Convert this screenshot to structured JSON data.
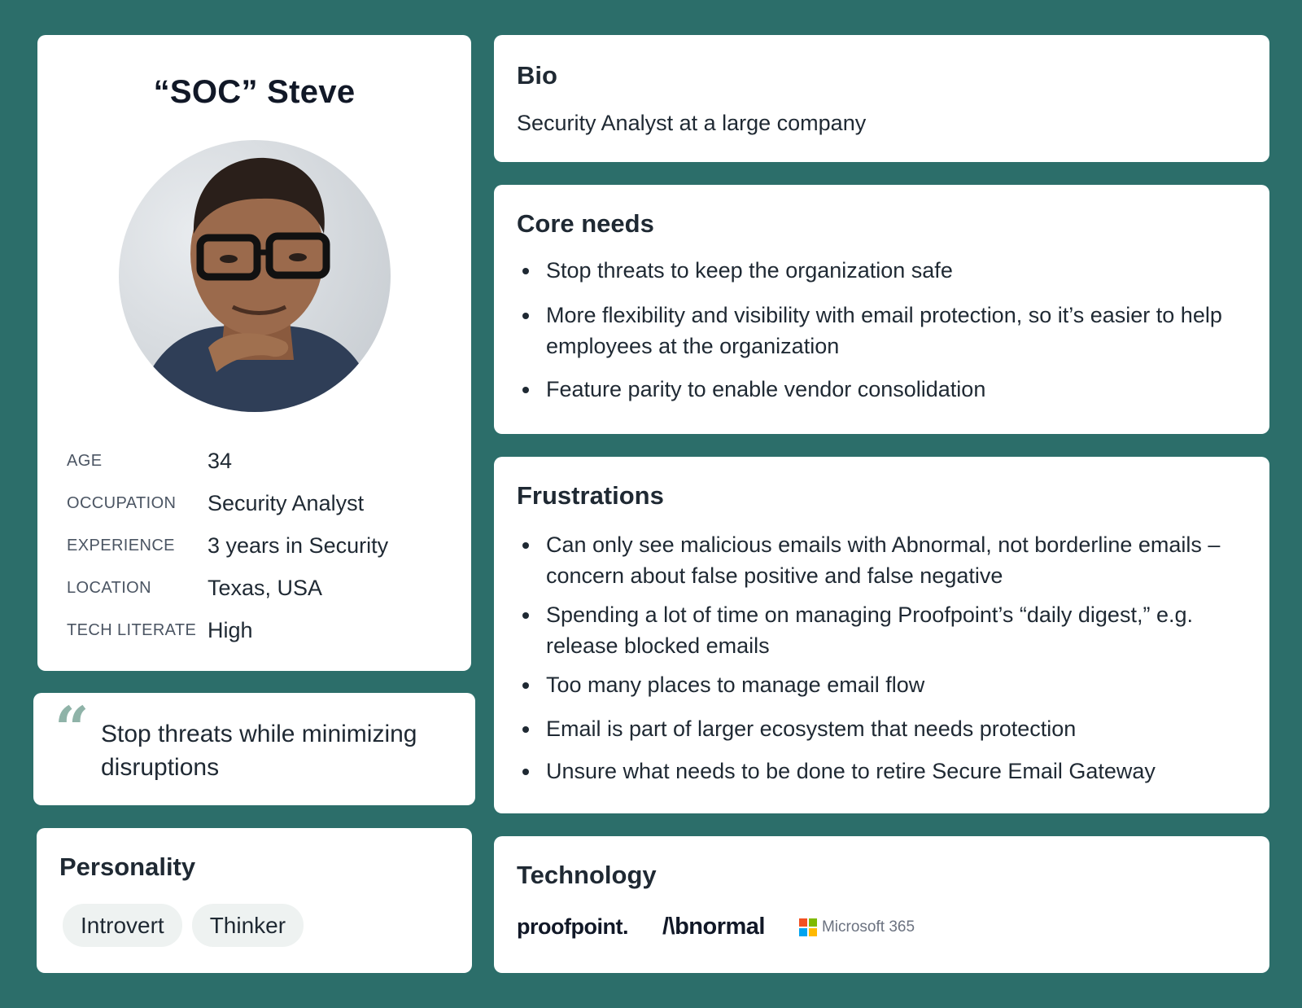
{
  "profile": {
    "name": "“SOC” Steve",
    "facts": [
      {
        "label": "AGE",
        "value": "34"
      },
      {
        "label": "OCCUPATION",
        "value": "Security Analyst"
      },
      {
        "label": "EXPERIENCE",
        "value": "3 years in Security"
      },
      {
        "label": "LOCATION",
        "value": "Texas, USA"
      },
      {
        "label": "TECH LITERATE",
        "value": "High"
      }
    ]
  },
  "quote": {
    "mark": "“",
    "text": "Stop threats while minimizing disruptions"
  },
  "personality": {
    "title": "Personality",
    "traits": [
      "Introvert",
      "Thinker"
    ]
  },
  "bio": {
    "title": "Bio",
    "text": "Security Analyst at a large company"
  },
  "core_needs": {
    "title": "Core needs",
    "items": [
      "Stop threats to keep the organization safe",
      "More flexibility and visibility with email protection, so it’s easier to help employees at the organization",
      "Feature parity to enable vendor consolidation"
    ]
  },
  "frustrations": {
    "title": "Frustrations",
    "items": [
      "Can only see malicious emails with Abnormal, not borderline emails – concern about false positive and false negative",
      "Spending a lot of time on managing Proofpoint’s “daily digest,” e.g. release blocked emails",
      "Too many places to manage email flow",
      "Email is part of larger ecosystem that needs protection",
      "Unsure what needs to be done to retire Secure Email Gateway"
    ]
  },
  "technology": {
    "title": "Technology",
    "logos": {
      "proofpoint": "proofpoint.",
      "abnormal": "/\\bnormal",
      "microsoft": "Microsoft 365"
    }
  },
  "colors": {
    "background": "#2c6e6a",
    "card": "#ffffff",
    "quote_mark": "#8fb3a8",
    "chip": "#eef2f1"
  }
}
